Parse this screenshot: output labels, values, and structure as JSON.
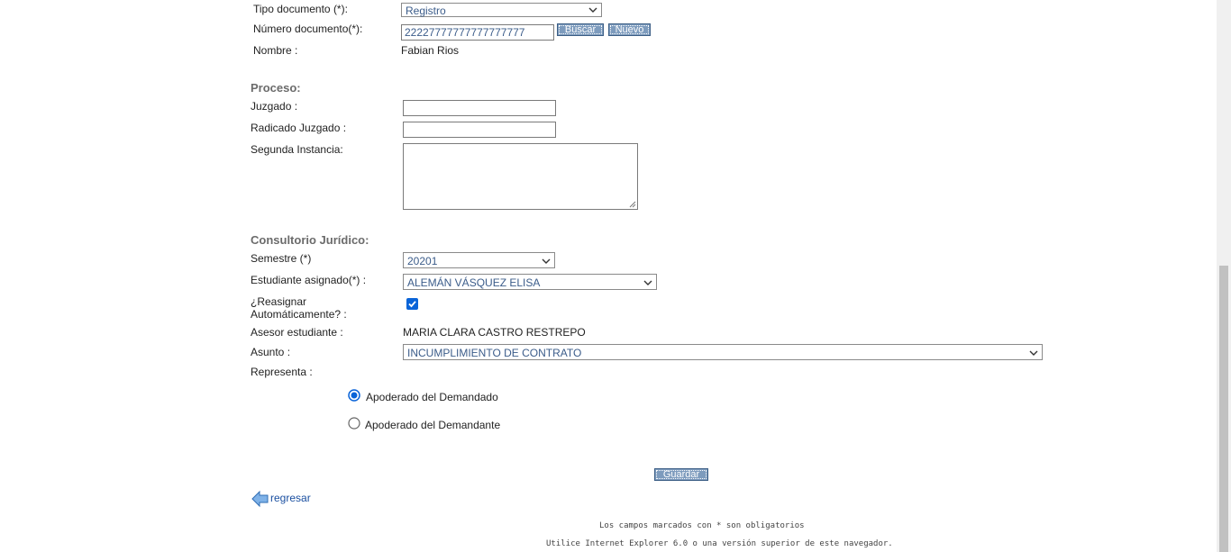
{
  "persona": {
    "tipo_label": "Tipo documento (*):",
    "tipo_value": "Registro",
    "numero_label": "Número documento(*):",
    "numero_value": "22227777777777777777",
    "buscar_label": "Buscar",
    "nuevo_label": "Nuevo",
    "nombre_label": "Nombre :",
    "nombre_value": "Fabian Rios"
  },
  "proceso": {
    "title": "Proceso:",
    "juzgado_label": "Juzgado :",
    "juzgado_value": "",
    "radicado_label": "Radicado Juzgado :",
    "radicado_value": "",
    "segunda_label": "Segunda Instancia:",
    "segunda_value": ""
  },
  "consultorio": {
    "title": "Consultorio Jurídico:",
    "semestre_label": "Semestre (*)",
    "semestre_value": "20201",
    "estudiante_label": "Estudiante asignado(*) :",
    "estudiante_value": "ALEMÁN VÁSQUEZ ELISA",
    "reasignar_label_1": "¿Reasignar",
    "reasignar_label_2": "Automáticamente? :",
    "reasignar_checked": true,
    "asesor_label": "Asesor estudiante :",
    "asesor_value": "MARIA CLARA CASTRO RESTREPO",
    "asunto_label": "Asunto :",
    "asunto_value": "INCUMPLIMIENTO DE CONTRATO",
    "representa_label": "Representa :",
    "options": [
      {
        "label": "Apoderado del Demandado",
        "selected": true
      },
      {
        "label": "Apoderado del Demandante",
        "selected": false
      }
    ]
  },
  "actions": {
    "guardar_label": "Guardar",
    "regresar_label": "regresar"
  },
  "footer": {
    "note": "Los campos marcados con * son obligatorios",
    "browser": "Utilice Internet Explorer 6.0 o una versión superior de este navegador."
  },
  "colors": {
    "button_bg": "#7d9bbd",
    "section_title": "#6b6b6b",
    "link": "#1a4fa0",
    "select_text": "#3b5c8a"
  }
}
